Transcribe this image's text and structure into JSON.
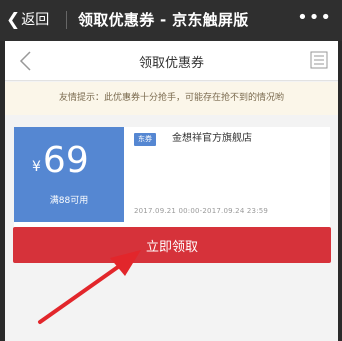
{
  "topbar": {
    "back_label": "返回",
    "title": "领取优惠券 - 京东触屏版",
    "more": "•••"
  },
  "navbar": {
    "title": "领取优惠券"
  },
  "tip": {
    "text": "友情提示：此优惠券十分抢手，可能存在抢不到的情况哟"
  },
  "coupon": {
    "currency": "¥",
    "amount": "69",
    "condition": "满88可用",
    "badge": "东券",
    "shop": "金想祥官方旗舰店",
    "validity": "2017.09.21 00:00-2017.09.24 23:59"
  },
  "action": {
    "claim_label": "立即领取"
  },
  "colors": {
    "topbar": "#2f2f2f",
    "coupon_blue": "#5587d2",
    "button_red": "#d6323a",
    "annotation_arrow": "#e2262b"
  }
}
